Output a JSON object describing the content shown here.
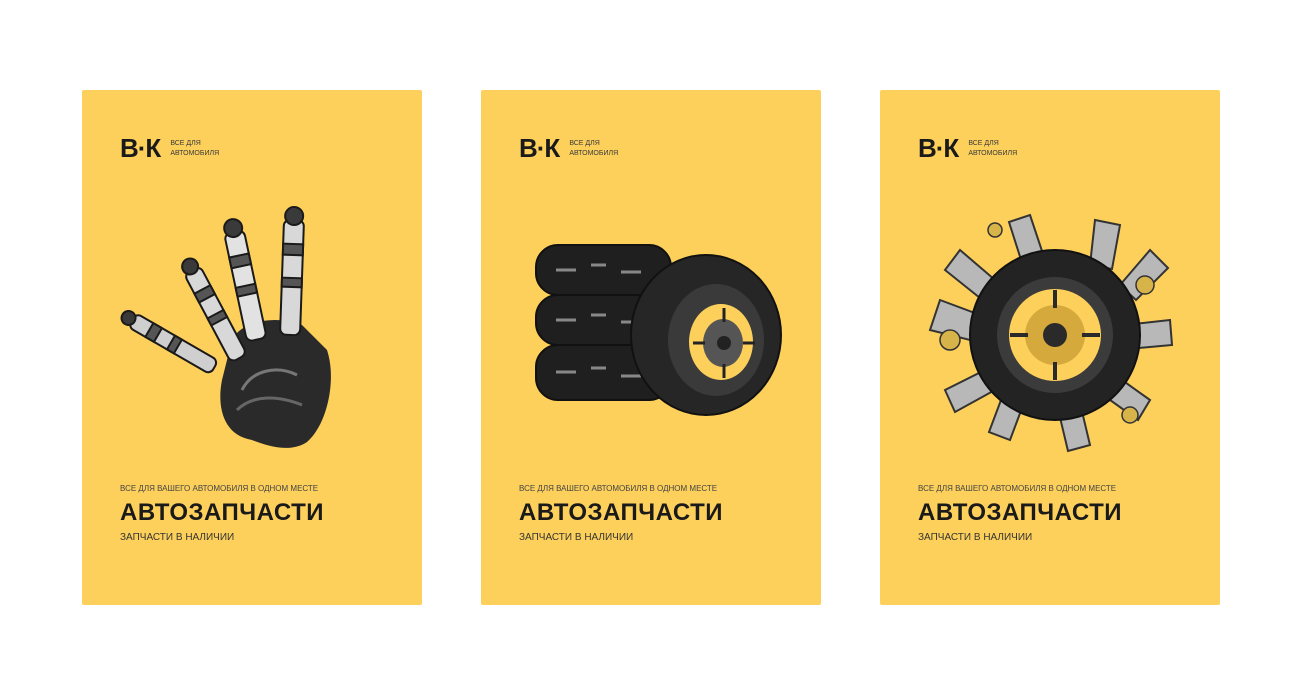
{
  "posters": [
    {
      "logo_mark": "В·К",
      "logo_line1": "ВСЕ ДЛЯ",
      "logo_line2": "АВТОМОБИЛЯ",
      "caption_top": "ВСЕ ДЛЯ ВАШЕГО АВТОМОБИЛЯ В ОДНОМ МЕСТЕ",
      "caption_title": "АВТОЗАПЧАСТИ",
      "caption_sub": "ЗАПЧАСТИ В НАЛИЧИИ",
      "art_icon": "hand-spark-plugs-icon"
    },
    {
      "logo_mark": "В·К",
      "logo_line1": "ВСЕ ДЛЯ",
      "logo_line2": "АВТОМОБИЛЯ",
      "caption_top": "ВСЕ ДЛЯ ВАШЕГО АВТОМОБИЛЯ В ОДНОМ МЕСТЕ",
      "caption_title": "АВТОЗАПЧАСТИ",
      "caption_sub": "ЗАПЧАСТИ В НАЛИЧИИ",
      "art_icon": "tires-stack-icon"
    },
    {
      "logo_mark": "В·К",
      "logo_line1": "ВСЕ ДЛЯ",
      "logo_line2": "АВТОМОБИЛЯ",
      "caption_top": "ВСЕ ДЛЯ ВАШЕГО АВТОМОБИЛЯ В ОДНОМ МЕСТЕ",
      "caption_title": "АВТОЗАПЧАСТИ",
      "caption_sub": "ЗАПЧАСТИ В НАЛИЧИИ",
      "art_icon": "wheel-parts-burst-icon"
    }
  ],
  "colors": {
    "poster_bg": "#fdd05c",
    "ink": "#1a1a1a",
    "page_bg": "#ffffff"
  }
}
